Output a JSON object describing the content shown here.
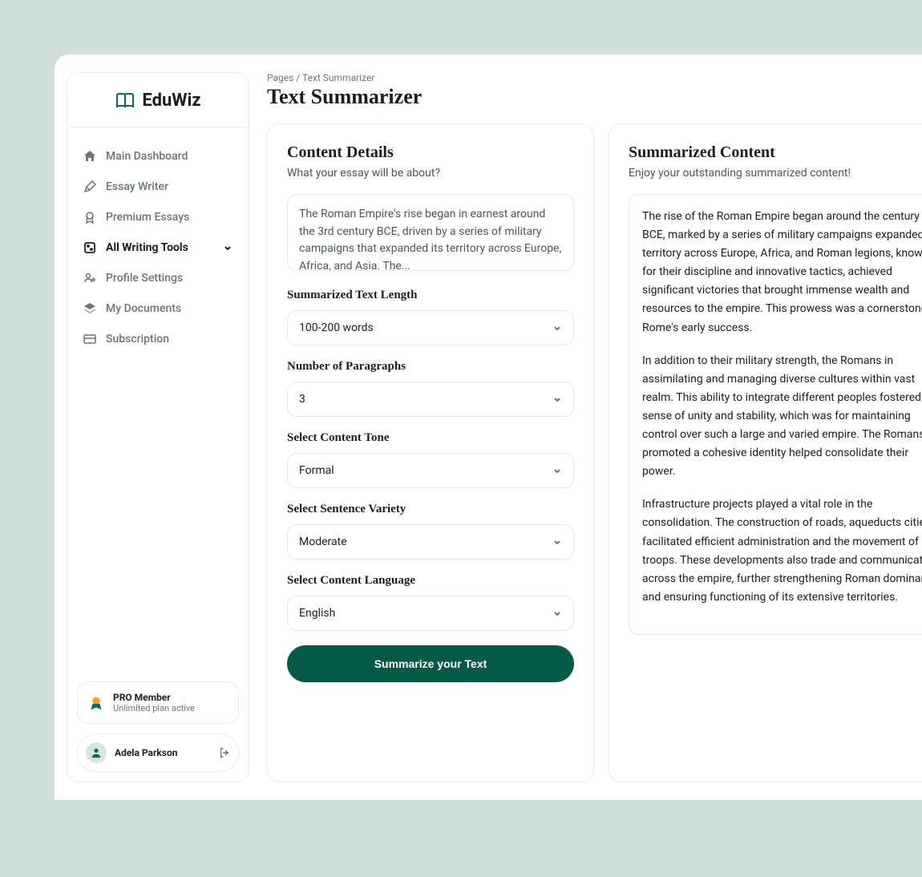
{
  "brand": "EduWiz",
  "breadcrumb": "Pages / Text Summarizer",
  "page_title": "Text Summarizer",
  "sidebar": {
    "items": [
      {
        "label": "Main Dashboard"
      },
      {
        "label": "Essay Writer"
      },
      {
        "label": "Premium Essays"
      },
      {
        "label": "All Writing Tools"
      },
      {
        "label": "Profile Settings"
      },
      {
        "label": "My Documents"
      },
      {
        "label": "Subscription"
      }
    ],
    "pro": {
      "title": "PRO Member",
      "subtitle": "Unlimited plan active"
    },
    "user": {
      "name": "Adela Parkson"
    }
  },
  "content_details": {
    "title": "Content Details",
    "subtitle": "What your essay will be about?",
    "input_text": "The Roman Empire's rise began in earnest around the 3rd century BCE, driven by a series of military campaigns that expanded its territory across Europe, Africa, and Asia. The...",
    "fields": {
      "length": {
        "label": "Summarized Text Length",
        "value": "100-200 words"
      },
      "paragraphs": {
        "label": "Number of Paragraphs",
        "value": "3"
      },
      "tone": {
        "label": "Select Content Tone",
        "value": "Formal"
      },
      "variety": {
        "label": "Select Sentence Variety",
        "value": "Moderate"
      },
      "language": {
        "label": "Select Content Language",
        "value": "English"
      }
    },
    "submit": "Summarize your Text"
  },
  "summarized": {
    "title": "Summarized Content",
    "subtitle": "Enjoy your outstanding summarized content!",
    "paragraphs": [
      "The rise of the Roman Empire began around the century BCE, marked by a series of military campaigns expanded its territory across Europe, Africa, and Roman legions, known for their discipline and innovative tactics, achieved significant victories that brought immense wealth and resources to the empire. This prowess was a cornerstone of Rome's early success.",
      "In addition to their military strength, the Romans in assimilating and managing diverse cultures within vast realm. This ability to integrate different peoples fostered a sense of unity and stability, which was for maintaining control over such a large and varied empire. The Romans promoted a cohesive identity helped consolidate their power.",
      "Infrastructure projects played a vital role in the consolidation. The construction of roads, aqueducts cities facilitated efficient administration and the movement of troops. These developments also trade and communication across the empire, further strengthening Roman dominance and ensuring functioning of its extensive territories."
    ]
  }
}
